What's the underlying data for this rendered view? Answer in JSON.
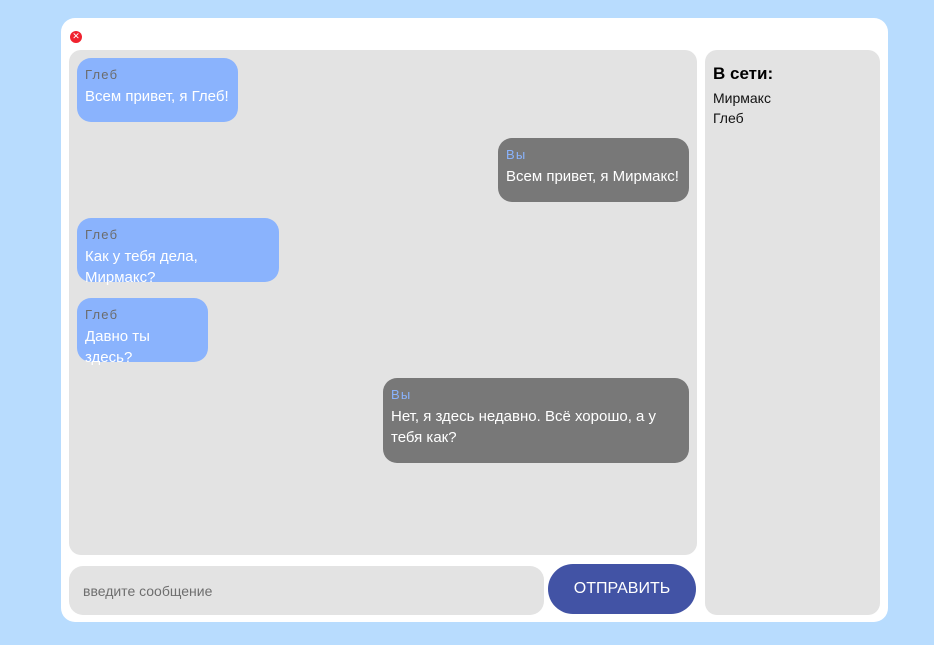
{
  "window": {
    "close_icon_glyph": "✕"
  },
  "messages": [
    {
      "author": "Глеб",
      "text": "Всем привет, я Глеб!",
      "direction": "incoming"
    },
    {
      "author": "Вы",
      "text": "Всем привет, я Мирмакс!",
      "direction": "outgoing"
    },
    {
      "author": "Глеб",
      "text": "Как у тебя дела, Мирмакс?",
      "direction": "incoming"
    },
    {
      "author": "Глеб",
      "text": "Давно ты здесь?",
      "direction": "incoming"
    },
    {
      "author": "Вы",
      "text": "Нет, я здесь недавно. Всё хорошо, а у тебя как?",
      "direction": "outgoing"
    }
  ],
  "composer": {
    "placeholder": "введите сообщение",
    "value": "",
    "send_label": "ОТПРАВИТЬ"
  },
  "online": {
    "title": "В сети:",
    "users": [
      "Мирмакс",
      "Глеб"
    ]
  },
  "colors": {
    "background": "#b8dcfe",
    "incoming_bubble": "#8ab3fd",
    "outgoing_bubble": "#787878",
    "send_button": "#4253a5",
    "close_button": "#f0222e"
  }
}
